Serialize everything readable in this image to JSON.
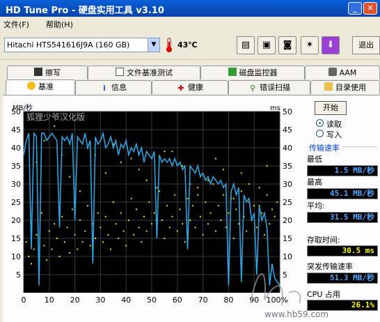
{
  "window": {
    "title": "HD Tune Pro - 硬盘实用工具 v3.10",
    "minimize": "_",
    "close": "×"
  },
  "menu": [
    {
      "label": "文件(F)"
    },
    {
      "label": "帮助(H)"
    }
  ],
  "toolbar": {
    "drive": "Hitachi HTS541616J9A (160 GB)",
    "temperature": "43℃",
    "exit_label": "退出",
    "icons": [
      "copy-text-icon",
      "copy-screenshot-icon",
      "save-icon",
      "options-icon",
      "download-icon"
    ]
  },
  "tabs_top": [
    {
      "label": "擦写",
      "icon": "trash-icon"
    },
    {
      "label": "文件基准测试",
      "icon": "file-benchmark-icon"
    },
    {
      "label": "磁盘监控器",
      "icon": "disk-monitor-icon"
    },
    {
      "label": "AAM",
      "icon": "speaker-icon"
    }
  ],
  "tabs_bottom": [
    {
      "label": "基准",
      "icon": "benchmark-icon",
      "active": true
    },
    {
      "label": "信息",
      "icon": "info-icon"
    },
    {
      "label": "健康",
      "icon": "health-icon"
    },
    {
      "label": "错误扫描",
      "icon": "error-scan-icon"
    },
    {
      "label": "目录使用",
      "icon": "folder-icon"
    }
  ],
  "controls": {
    "start_label": "开始",
    "read_label": "读取",
    "write_label": "写入",
    "read_selected": true,
    "transfer_rate_title": "传输速率",
    "min_label": "最低",
    "min_value": "1.5 MB/秒",
    "max_label": "最高",
    "max_value": "45.1 MB/秒",
    "avg_label": "平均:",
    "avg_value": "31.5 MB/秒",
    "access_label": "存取时间:",
    "access_value": "30.5 ms",
    "burst_label": "突发传输速率",
    "burst_value": "51.3 MB/秒",
    "cpu_label": "CPU 占用",
    "cpu_value": "26.1%"
  },
  "watermark_text": "www.hb59.com",
  "chart_data": {
    "type": "line",
    "chart_label": "狐狸少爷汉化版",
    "left_unit": "MB/秒",
    "right_unit": "ms",
    "x_ticks": [
      "0",
      "10",
      "20",
      "30",
      "40",
      "50",
      "60",
      "70",
      "80",
      "90",
      "100%"
    ],
    "y_left_ticks": [
      5,
      10,
      15,
      20,
      25,
      30,
      35,
      40,
      45,
      50
    ],
    "y_right_ticks": [
      5,
      10,
      15,
      20,
      25,
      30,
      35,
      40,
      45,
      50
    ],
    "xlim": [
      0,
      100
    ],
    "ylim": [
      0,
      50
    ],
    "grid": true,
    "colors": {
      "background": "#000000",
      "grid": "#3a3a3a",
      "line": "#2fa3e0",
      "points": "#e6e600",
      "axis_text": "#000000"
    },
    "series": [
      {
        "x": [
          0,
          1,
          2,
          3,
          4,
          5,
          6,
          7,
          8,
          9,
          10,
          11,
          12,
          13,
          14,
          15,
          16,
          17,
          18,
          19,
          20,
          21,
          22,
          23,
          24,
          25,
          26,
          27,
          28,
          29,
          30,
          31,
          32,
          33,
          34,
          35,
          36,
          37,
          38,
          39,
          40,
          41,
          42,
          43,
          44,
          45,
          46,
          47,
          48,
          49,
          50,
          51,
          52,
          53,
          54,
          55,
          56,
          57,
          58,
          59,
          60,
          61,
          62,
          63,
          64,
          65,
          66,
          67,
          68,
          69,
          70,
          71,
          72,
          73,
          74,
          75,
          76,
          77,
          78,
          79,
          80,
          81,
          82,
          83,
          84,
          85,
          86,
          87,
          88,
          89,
          90,
          91,
          92,
          93,
          94,
          95,
          96,
          97,
          98,
          99,
          100
        ],
        "y": [
          38,
          42,
          44,
          12,
          44,
          43,
          2,
          44,
          44,
          42,
          43,
          44,
          43,
          42,
          18,
          43,
          42,
          43,
          41,
          44,
          20,
          43,
          42,
          41,
          44,
          40,
          42,
          8,
          43,
          41,
          42,
          44,
          40,
          41,
          43,
          40,
          42,
          38,
          41,
          40,
          42,
          38,
          40,
          39,
          41,
          38,
          40,
          36,
          39,
          38,
          37,
          39,
          15,
          38,
          36,
          37,
          36,
          37,
          35,
          37,
          35,
          36,
          34,
          35,
          12,
          35,
          34,
          33,
          35,
          32,
          33,
          31,
          32,
          30,
          32,
          31,
          30,
          31,
          29,
          30,
          2,
          28,
          30,
          27,
          29,
          3,
          27,
          25,
          26,
          20,
          22,
          5,
          24,
          20,
          22,
          18,
          2,
          8,
          4,
          3,
          2
        ]
      },
      {
        "x": [
          1,
          2,
          3,
          3,
          4,
          5,
          6,
          7,
          8,
          9,
          10,
          11,
          12,
          13,
          14,
          15,
          16,
          17,
          18,
          19,
          20,
          21,
          22,
          23,
          24,
          25,
          26,
          27,
          28,
          29,
          30,
          31,
          32,
          33,
          34,
          35,
          36,
          37,
          38,
          39,
          40,
          41,
          42,
          43,
          44,
          45,
          46,
          47,
          48,
          49,
          50,
          51,
          52,
          53,
          54,
          55,
          56,
          57,
          58,
          59,
          60,
          61,
          62,
          63,
          64,
          65,
          66,
          67,
          68,
          69,
          70,
          71,
          72,
          73,
          74,
          75,
          76,
          77,
          78,
          79,
          80,
          81,
          82,
          83,
          84,
          85,
          86,
          87,
          88,
          89,
          90,
          91,
          92,
          93,
          94,
          95,
          96,
          97,
          98,
          99,
          5,
          15,
          25,
          35,
          45,
          55,
          65,
          75,
          85,
          95,
          8,
          18,
          28,
          38,
          48,
          58,
          68,
          78,
          88,
          12,
          22,
          32,
          42,
          52,
          62,
          72,
          82,
          92
        ],
        "y": [
          14,
          10,
          18,
          8,
          12,
          16,
          11,
          22,
          13,
          9,
          17,
          12,
          19,
          15,
          10,
          21,
          14,
          18,
          11,
          23,
          16,
          12,
          20,
          14,
          17,
          24,
          13,
          19,
          15,
          22,
          18,
          14,
          21,
          16,
          12,
          25,
          19,
          15,
          22,
          17,
          13,
          20,
          26,
          16,
          23,
          18,
          14,
          21,
          17,
          25,
          19,
          22,
          16,
          28,
          20,
          15,
          24,
          18,
          21,
          27,
          17,
          23,
          19,
          14,
          26,
          20,
          24,
          18,
          29,
          21,
          16,
          25,
          19,
          22,
          30,
          17,
          24,
          20,
          27,
          18,
          22,
          26,
          15,
          23,
          19,
          28,
          21,
          17,
          25,
          20,
          24,
          18,
          29,
          22,
          16,
          27,
          19,
          23,
          21,
          25,
          36,
          38,
          40,
          41,
          34,
          39,
          30,
          37,
          33,
          35,
          42,
          32,
          38,
          36,
          31,
          39,
          27,
          34,
          30,
          46,
          28,
          33,
          37,
          29,
          35,
          31,
          26,
          24
        ]
      }
    ]
  }
}
